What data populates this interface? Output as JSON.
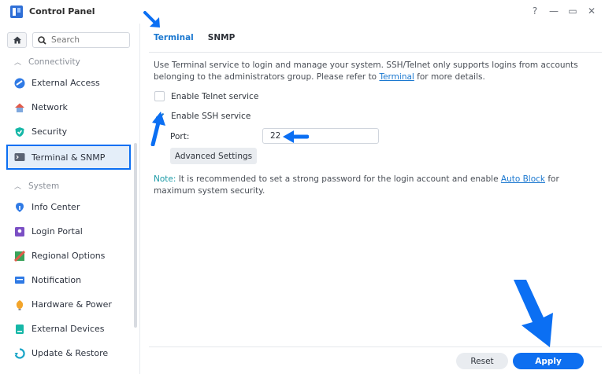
{
  "window": {
    "title": "Control Panel",
    "controls": {
      "help": "?",
      "minimize": "—",
      "maximize": "▭",
      "close": "✕"
    }
  },
  "sidebar": {
    "search_placeholder": "Search",
    "groups": [
      {
        "label": "Connectivity"
      },
      {
        "label": "System"
      }
    ],
    "items": [
      {
        "label": "External Access",
        "icon": "external-access-icon"
      },
      {
        "label": "Network",
        "icon": "network-icon"
      },
      {
        "label": "Security",
        "icon": "security-shield-icon"
      },
      {
        "label": "Terminal & SNMP",
        "icon": "terminal-icon",
        "active": true
      },
      {
        "label": "Info Center",
        "icon": "info-center-icon"
      },
      {
        "label": "Login Portal",
        "icon": "login-portal-icon"
      },
      {
        "label": "Regional Options",
        "icon": "regional-options-icon"
      },
      {
        "label": "Notification",
        "icon": "notification-icon"
      },
      {
        "label": "Hardware & Power",
        "icon": "hardware-power-icon"
      },
      {
        "label": "External Devices",
        "icon": "external-devices-icon"
      },
      {
        "label": "Update & Restore",
        "icon": "update-restore-icon"
      }
    ]
  },
  "main": {
    "tabs": [
      {
        "label": "Terminal",
        "active": true
      },
      {
        "label": "SNMP",
        "active": false
      }
    ],
    "description": {
      "before": "Use Terminal service to login and manage your system. SSH/Telnet only supports logins from accounts belonging to the administrators group. Please refer to ",
      "link": "Terminal",
      "after": " for more details."
    },
    "telnet": {
      "label": "Enable Telnet service",
      "checked": false
    },
    "ssh": {
      "label": "Enable SSH service",
      "checked": true
    },
    "port": {
      "label": "Port:",
      "value": "22"
    },
    "advanced_button": "Advanced Settings",
    "note": {
      "label": "Note:",
      "before": " It is recommended to set a strong password for the login account and enable ",
      "link": "Auto Block",
      "after": " for maximum system security."
    },
    "footer": {
      "reset": "Reset",
      "apply": "Apply"
    }
  },
  "colors": {
    "accent": "#0e6ff0",
    "link": "#1b78d0",
    "annotation_arrow": "#0b6ff3"
  }
}
